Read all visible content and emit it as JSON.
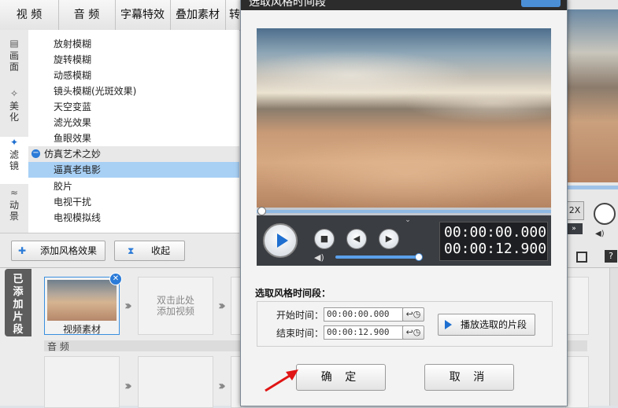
{
  "top_tabs": [
    "视 频",
    "音 频",
    "字幕特效",
    "叠加素材",
    "转"
  ],
  "left_tabs": [
    "画面",
    "美化",
    "滤镜",
    "动景"
  ],
  "effects": {
    "items": [
      "放射模糊",
      "旋转模糊",
      "动感模糊",
      "镜头模糊(光斑效果)",
      "天空变蓝",
      "滤光效果",
      "鱼眼效果"
    ],
    "group": "仿真艺术之妙",
    "selected": "逼真老电影",
    "more": [
      "胶片",
      "电视干扰",
      "电视模拟线"
    ]
  },
  "buttons": {
    "add_style": "添加风格效果",
    "collapse": "收起"
  },
  "timeline": {
    "added_label": "已添加片段",
    "clip_label": "视频素材",
    "add_video_hint": "双击此处\n添加视频",
    "audio_label": "音 频"
  },
  "dialog": {
    "title": "选取风格时间段",
    "time_start": "00:00:00.000",
    "time_end": "00:00:12.900",
    "progress": 0,
    "volume": 1.0,
    "section_label": "选取风格时间段：",
    "start_label": "开始时间：",
    "end_label": "结束时间：",
    "start_value": "00:00:00.000",
    "end_value": "00:00:12.900",
    "play_selected": "播放选取的片段",
    "ok": "确 定",
    "cancel": "取 消"
  },
  "right_partial": {
    "speed": "2X"
  },
  "accent_color": "#1e6fd0"
}
